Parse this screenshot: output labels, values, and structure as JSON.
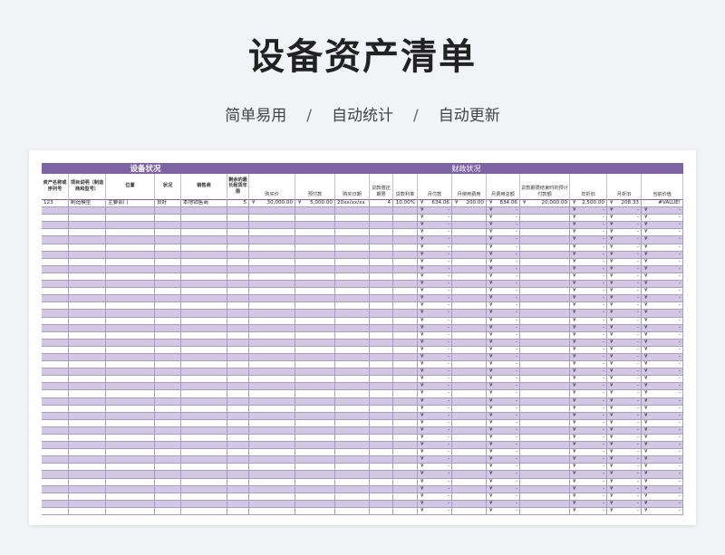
{
  "page": {
    "title": "设备资产清单",
    "tagline": [
      "简单易用",
      "自动统计",
      "自动更新"
    ],
    "separator": "/"
  },
  "sheet": {
    "group_left": "设备状况",
    "group_right": "财政状况",
    "headers": [
      "资产名称或序列号",
      "项目说明（制造商和型号）",
      "位置",
      "状况",
      "销售商",
      "剩余的最长租赁年限",
      "购买价",
      "预付款",
      "购买日期",
      "贷款偿还期限",
      "贷款利率",
      "月付款",
      "月使用费用",
      "月费用总额",
      "贷款期限结束时的预计付款额",
      "年折旧",
      "月折旧",
      "当前价值"
    ],
    "currency": "¥",
    "dash": "-",
    "first_row": {
      "asset": "123",
      "description": "制造模型",
      "location": "主要部门",
      "condition": "良好",
      "vendor": "本地销售商",
      "lease_years": "5",
      "purchase_price": "30,000.00",
      "down_payment": "5,000.00",
      "purchase_date": "20xx/xx/xx",
      "loan_term": "4",
      "loan_rate": "10.00%",
      "monthly_payment": "634.06",
      "monthly_use_cost": "200.00",
      "monthly_total": "834.06",
      "end_payment": "20,000.00",
      "annual_dep": "2,500.00",
      "monthly_dep": "208.33",
      "current_value": "#VALUE!"
    },
    "empty_rows": 42
  },
  "colors": {
    "accent": "#7d63a4",
    "stripe": "#d3c8e4",
    "background": "#f2f3f6"
  }
}
